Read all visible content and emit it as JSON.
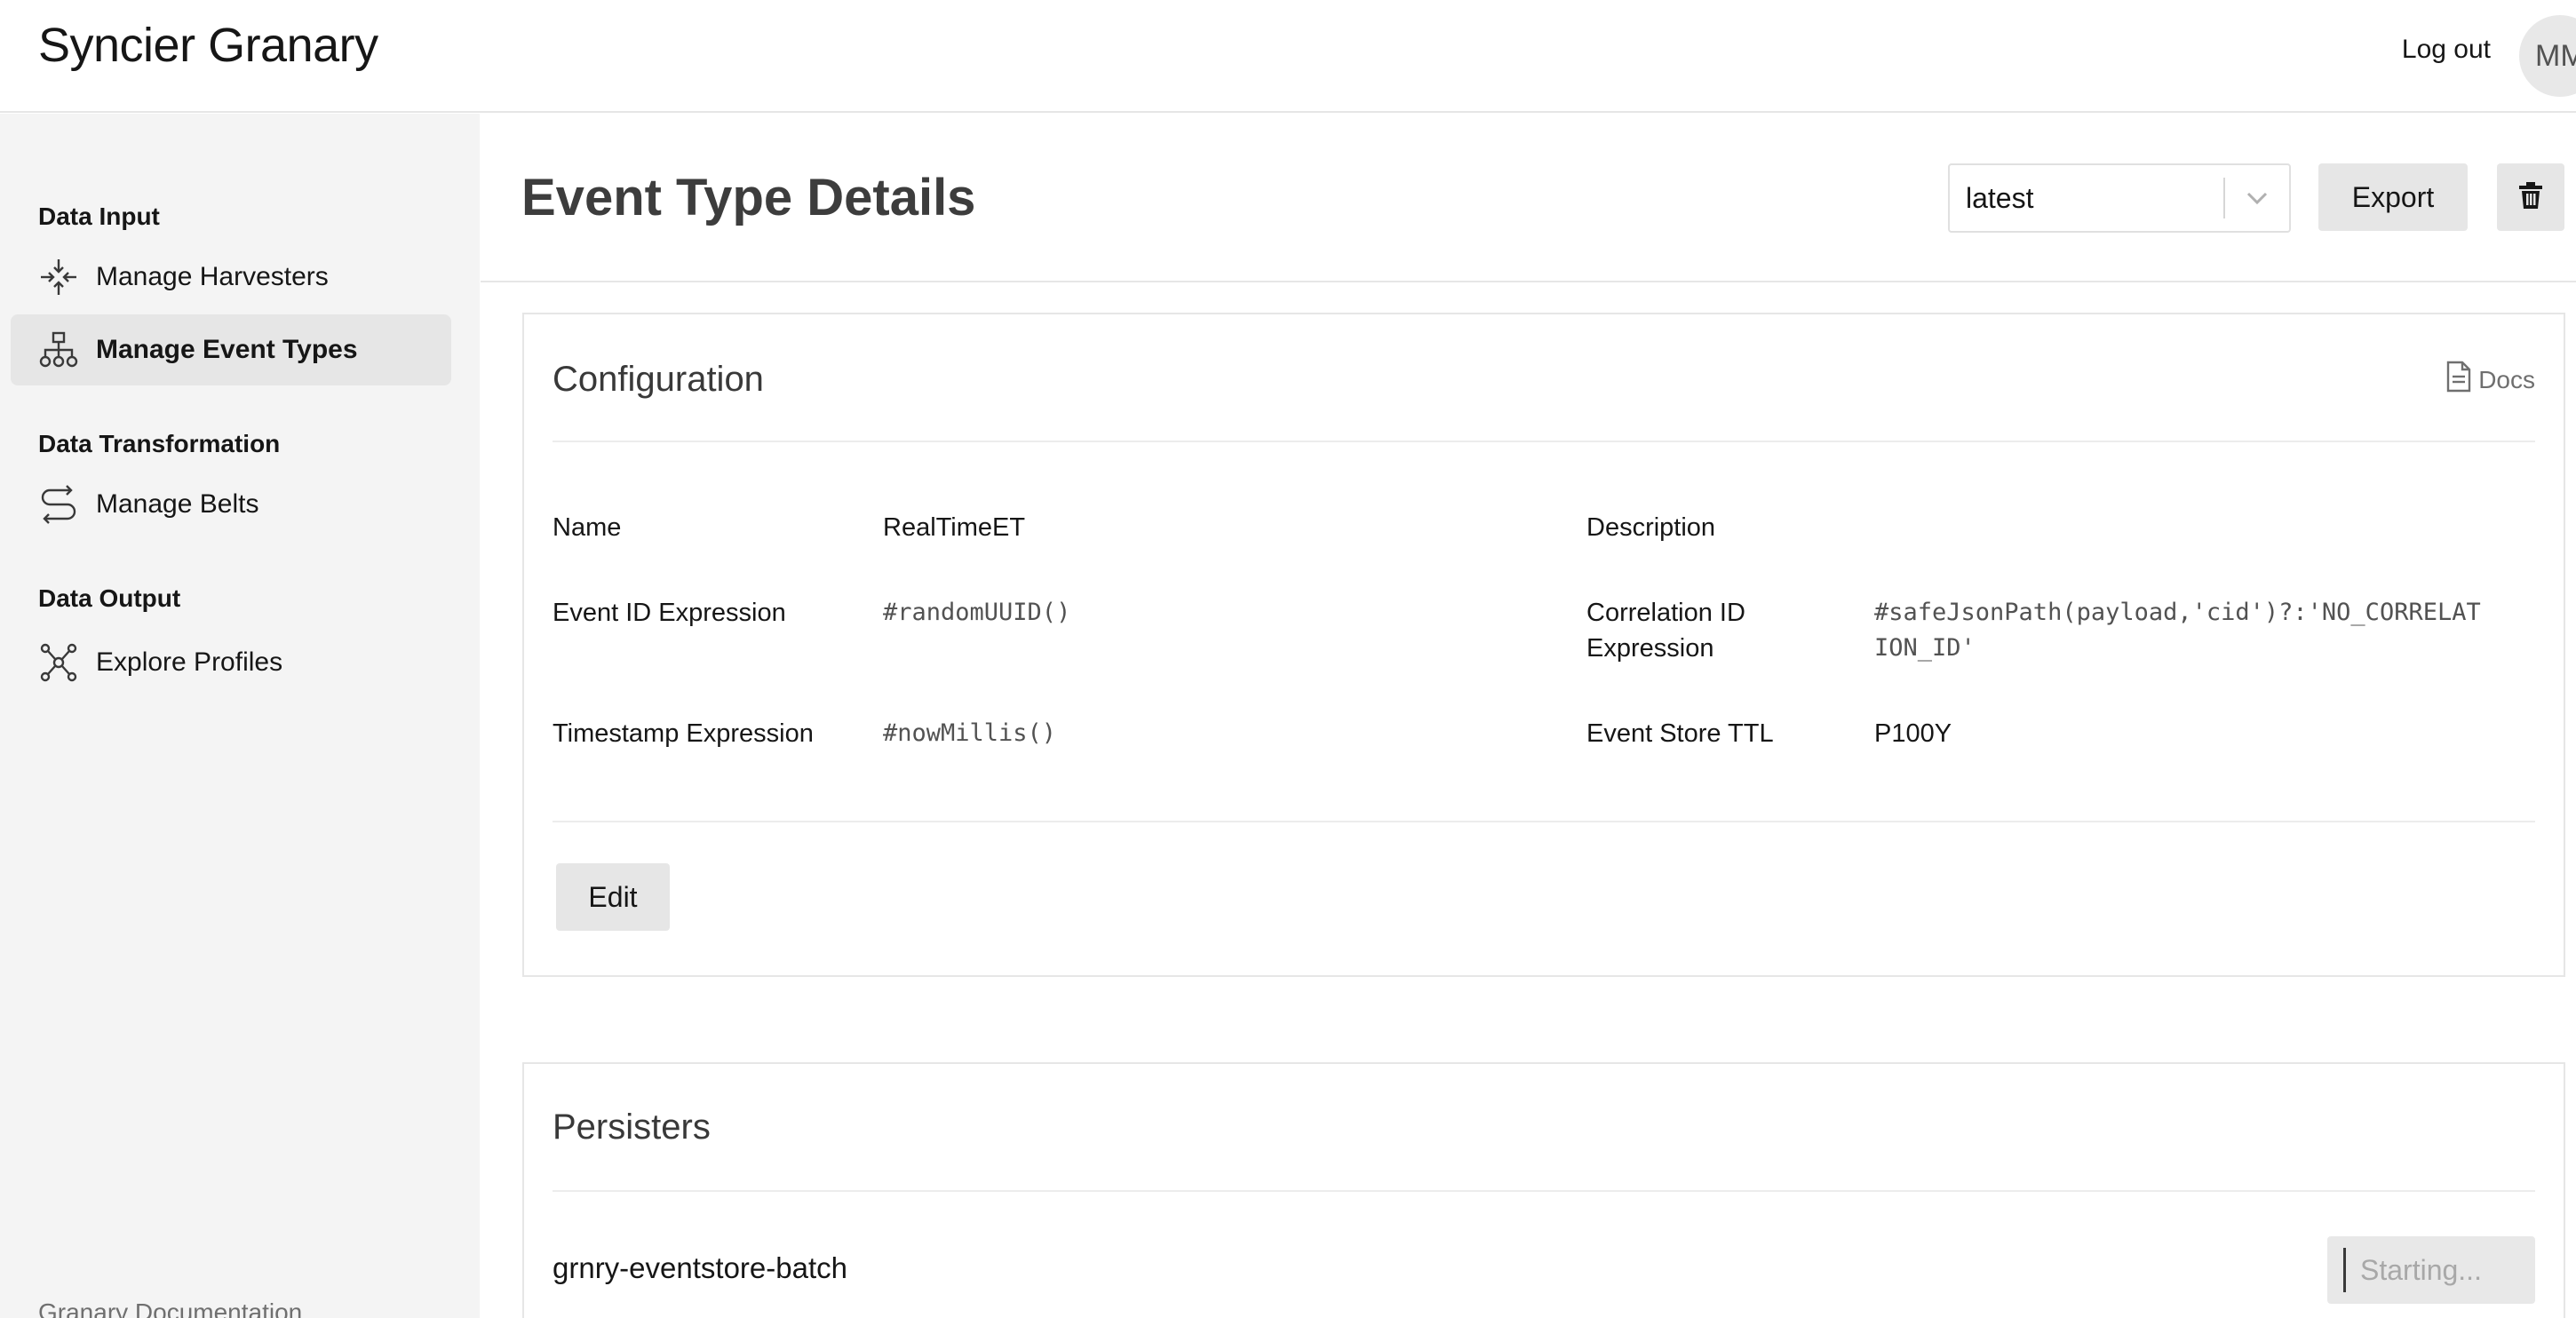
{
  "app": {
    "title": "Syncier Granary"
  },
  "topbar": {
    "logout_label": "Log out",
    "avatar_initials": "MM"
  },
  "sidebar": {
    "sections": [
      {
        "title": "Data Input",
        "items": [
          {
            "label": "Manage Harvesters",
            "icon": "harvester-icon"
          },
          {
            "label": "Manage Event Types",
            "icon": "hierarchy-icon",
            "active": true
          }
        ]
      },
      {
        "title": "Data Transformation",
        "items": [
          {
            "label": "Manage Belts",
            "icon": "belt-route-icon"
          }
        ]
      },
      {
        "title": "Data Output",
        "items": [
          {
            "label": "Explore Profiles",
            "icon": "network-icon"
          }
        ]
      }
    ],
    "footer_link": "Granary Documentation"
  },
  "header": {
    "title": "Event Type Details",
    "version_select": "latest",
    "export_label": "Export",
    "delete_icon": "trash-icon"
  },
  "configuration": {
    "title": "Configuration",
    "docs_label": "Docs",
    "fields": {
      "name_label": "Name",
      "name_value": "RealTimeET",
      "description_label": "Description",
      "description_value": "",
      "event_id_label": "Event ID Expression",
      "event_id_value": "#randomUUID()",
      "correlation_id_label_line1": "Correlation ID",
      "correlation_id_label_line2": "Expression",
      "correlation_id_value_line1": "#safeJsonPath(payload,'cid')?:'NO_CORRELAT",
      "correlation_id_value_line2": "ION_ID'",
      "timestamp_label": "Timestamp Expression",
      "timestamp_value": "#nowMillis()",
      "ttl_label": "Event Store TTL",
      "ttl_value": "P100Y"
    },
    "edit_label": "Edit"
  },
  "persisters": {
    "title": "Persisters",
    "items": [
      {
        "name": "grnry-eventstore-batch",
        "status": "Starting..."
      }
    ]
  }
}
